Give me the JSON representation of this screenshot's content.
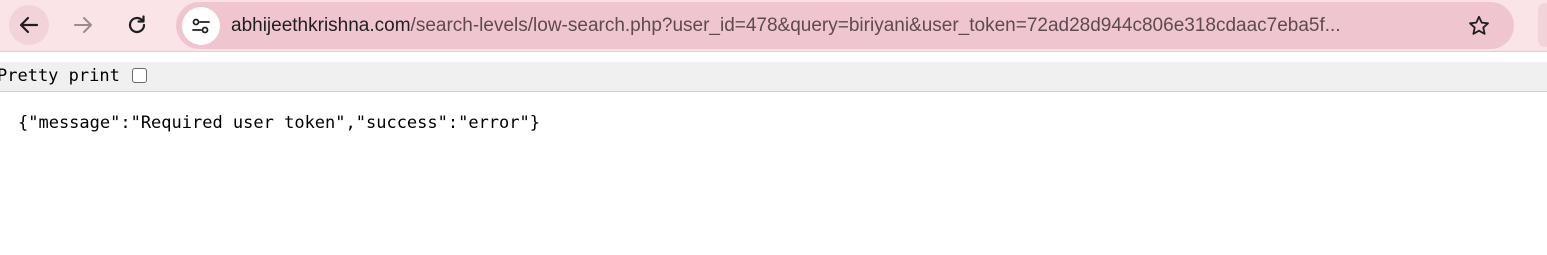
{
  "browser": {
    "url_host": "abhijeethkrishna.com",
    "url_rest": "/search-levels/low-search.php?user_id=478&query=biriyani&user_token=72ad28d944c806e318cdaac7eba5f..."
  },
  "viewer": {
    "pretty_print_label": "Pretty print",
    "pretty_print_checked": false,
    "body": "{\"message\":\"Required user token\",\"success\":\"error\"}"
  },
  "icons": {
    "back": "arrow-left-icon",
    "forward": "arrow-right-icon",
    "reload": "reload-icon",
    "site_info": "tune-icon",
    "bookmark": "star-icon"
  },
  "colors": {
    "toolbar": "#fbe4e8",
    "omnibox": "#efc6cf"
  }
}
